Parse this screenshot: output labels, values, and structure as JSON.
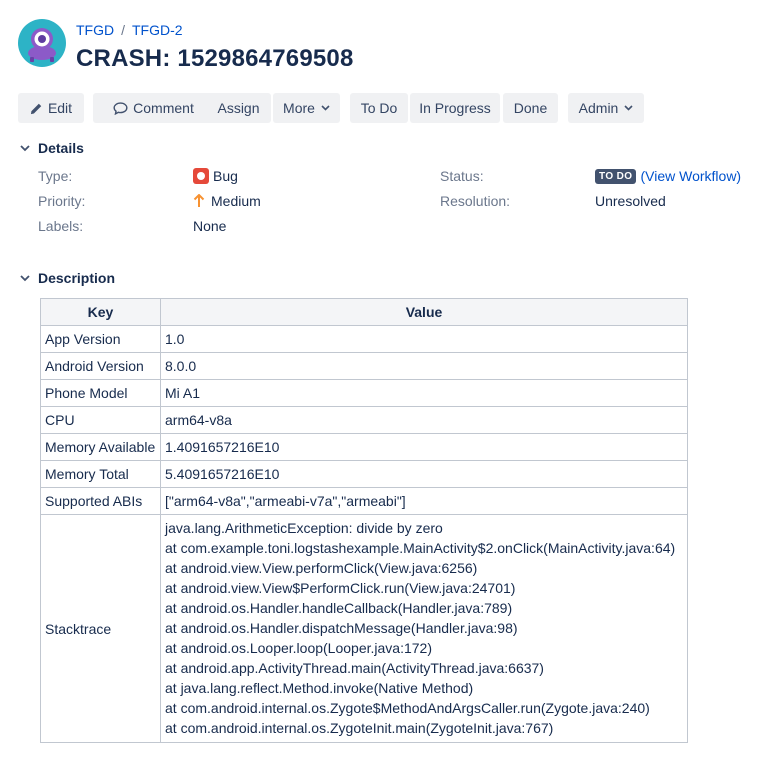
{
  "breadcrumb": {
    "project": "TFGD",
    "issue_key": "TFGD-2",
    "separator": "/"
  },
  "title": "CRASH: 1529864769508",
  "toolbar": {
    "edit": "Edit",
    "comment": "Comment",
    "assign": "Assign",
    "more": "More",
    "todo": "To Do",
    "in_progress": "In Progress",
    "done": "Done",
    "admin": "Admin"
  },
  "details": {
    "heading": "Details",
    "type_label": "Type:",
    "type_value": "Bug",
    "priority_label": "Priority:",
    "priority_value": "Medium",
    "labels_label": "Labels:",
    "labels_value": "None",
    "status_label": "Status:",
    "status_value": "TO DO",
    "view_workflow": "(View Workflow)",
    "resolution_label": "Resolution:",
    "resolution_value": "Unresolved"
  },
  "description": {
    "heading": "Description",
    "columns": [
      "Key",
      "Value"
    ],
    "rows": [
      {
        "key": "App Version",
        "value": "1.0"
      },
      {
        "key": "Android Version",
        "value": "8.0.0"
      },
      {
        "key": "Phone Model",
        "value": "Mi A1"
      },
      {
        "key": "CPU",
        "value": "arm64-v8a"
      },
      {
        "key": "Memory Available",
        "value": "1.4091657216E10"
      },
      {
        "key": "Memory Total",
        "value": "5.4091657216E10"
      },
      {
        "key": "Supported ABIs",
        "value": "[\"arm64-v8a\",\"armeabi-v7a\",\"armeabi\"]"
      }
    ],
    "stacktrace_key": "Stacktrace",
    "stacktrace": [
      "java.lang.ArithmeticException: divide by zero",
      "at com.example.toni.logstashexample.MainActivity$2.onClick(MainActivity.java:64)",
      "at android.view.View.performClick(View.java:6256)",
      "at android.view.View$PerformClick.run(View.java:24701)",
      "at android.os.Handler.handleCallback(Handler.java:789)",
      "at android.os.Handler.dispatchMessage(Handler.java:98)",
      "at android.os.Looper.loop(Looper.java:172)",
      "at android.app.ActivityThread.main(ActivityThread.java:6637)",
      "at java.lang.reflect.Method.invoke(Native Method)",
      "at com.android.internal.os.Zygote$MethodAndArgsCaller.run(Zygote.java:240)",
      "at com.android.internal.os.ZygoteInit.main(ZygoteInit.java:767)"
    ]
  },
  "colors": {
    "link": "#0052cc",
    "bug": "#e5493a",
    "priority_medium": "#f79232",
    "lozenge": "#42526e",
    "button_bg": "#f0f1f3"
  },
  "icons": {
    "avatar": "project-avatar-icon",
    "edit": "pencil-icon",
    "comment": "comment-icon",
    "dropdown": "chevron-down-icon",
    "bug": "bug-icon",
    "priority": "arrow-up-icon",
    "toggle": "chevron-down-icon"
  }
}
